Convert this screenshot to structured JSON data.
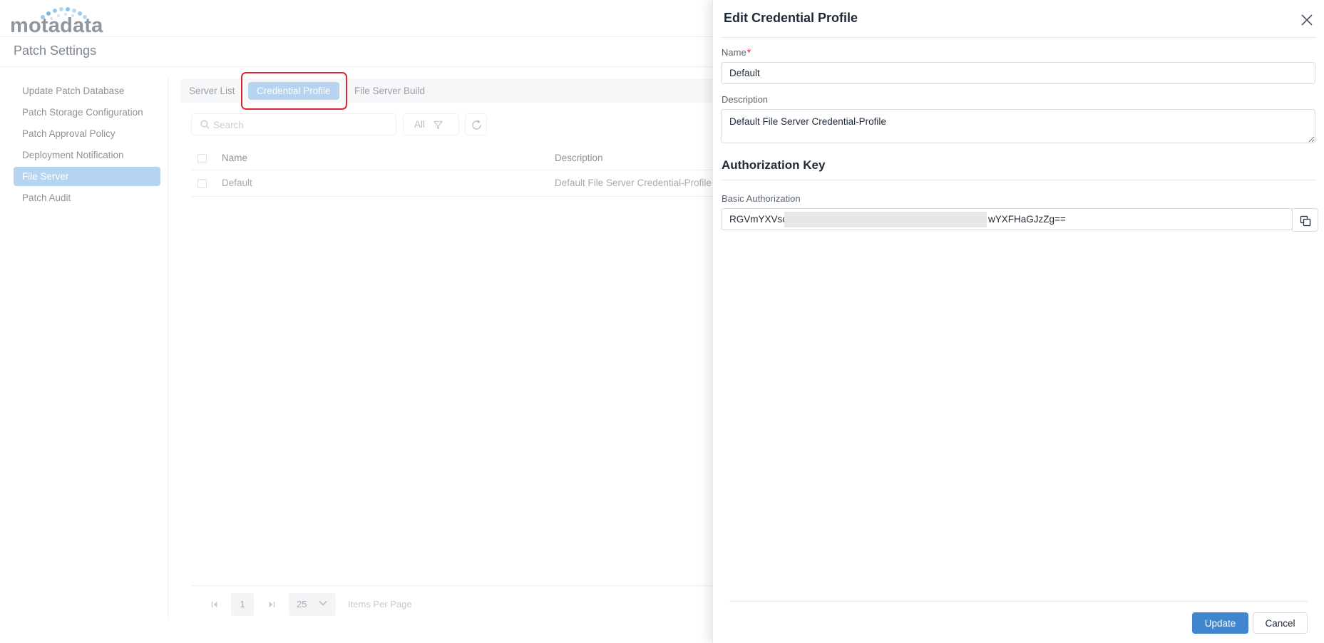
{
  "brand": {
    "logo_text": "motadata"
  },
  "page": {
    "title": "Patch Settings"
  },
  "sidebar": {
    "items": [
      {
        "label": "Update Patch Database",
        "active": false
      },
      {
        "label": "Patch Storage Configuration",
        "active": false
      },
      {
        "label": "Patch Approval Policy",
        "active": false
      },
      {
        "label": "Deployment Notification",
        "active": false
      },
      {
        "label": "File Server",
        "active": true
      },
      {
        "label": "Patch Audit",
        "active": false
      }
    ]
  },
  "tabs": [
    {
      "label": "Server List",
      "active": false
    },
    {
      "label": "Credential Profile",
      "active": true
    },
    {
      "label": "File Server Build",
      "active": false
    }
  ],
  "toolbar": {
    "search_placeholder": "Search",
    "filter_value": "All"
  },
  "table": {
    "columns": [
      "Name",
      "Description"
    ],
    "rows": [
      {
        "name": "Default",
        "description": "Default File Server Credential-Profile"
      }
    ]
  },
  "pagination": {
    "current_page": "1",
    "page_size": "25",
    "page_size_label": "Items Per Page"
  },
  "drawer": {
    "title": "Edit Credential Profile",
    "name_label": "Name",
    "name_required_mark": "*",
    "name_value": "Default",
    "description_label": "Description",
    "description_value": "Default File Server Credential-Profile",
    "section_title": "Authorization Key",
    "auth_label": "Basic Authorization",
    "auth_prefix": "RGVmYXVsc",
    "auth_suffix": "wYXFHaGJzZg==",
    "update_label": "Update",
    "cancel_label": "Cancel"
  },
  "colors": {
    "accent": "#3f86cf",
    "active_tab": "#b6d3ef",
    "highlight": "#e0262c"
  }
}
